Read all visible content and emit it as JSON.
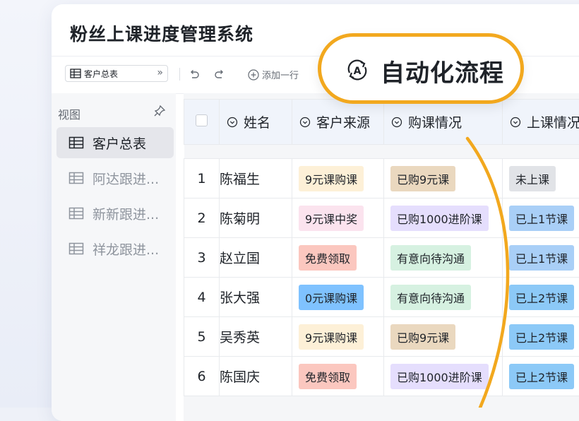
{
  "app": {
    "title": "粉丝上课进度管理系统"
  },
  "toolbar": {
    "view_name": "客户总表",
    "view_icon": "table-icon",
    "expand_icon": "double-chevron-right-icon",
    "undo_icon": "undo-icon",
    "redo_icon": "redo-icon",
    "add_row_label": "添加一行",
    "add_row_icon": "plus-circle-icon"
  },
  "sidebar": {
    "header": "视图",
    "pin_icon": "pin-icon",
    "items": [
      {
        "label": "客户总表",
        "active": true,
        "icon": "table-icon"
      },
      {
        "label": "阿达跟进...",
        "active": false,
        "icon": "table-icon"
      },
      {
        "label": "新新跟进...",
        "active": false,
        "icon": "table-icon"
      },
      {
        "label": "祥龙跟进...",
        "active": false,
        "icon": "table-icon"
      }
    ]
  },
  "table": {
    "columns": [
      "姓名",
      "客户来源",
      "购课情况",
      "上课情况"
    ],
    "column_icon": "select-field-icon",
    "rows": [
      {
        "num": "1",
        "name": "陈福生",
        "source": "9元课购课",
        "purchase": "已购9元课",
        "class": "未上课"
      },
      {
        "num": "2",
        "name": "陈菊明",
        "source": "9元课中奖",
        "purchase": "已购1000进阶课",
        "class": "已上1节课"
      },
      {
        "num": "3",
        "name": "赵立国",
        "source": "免费领取",
        "purchase": "有意向待沟通",
        "class": "已上1节课"
      },
      {
        "num": "4",
        "name": "张大强",
        "source": "0元课购课",
        "purchase": "有意向待沟通",
        "class": "已上2节课"
      },
      {
        "num": "5",
        "name": "吴秀英",
        "source": "9元课购课",
        "purchase": "已购9元课",
        "class": "已上2节课"
      },
      {
        "num": "6",
        "name": "陈国庆",
        "source": "免费领取",
        "purchase": "已购1000进阶课",
        "class": "已上2节课"
      }
    ]
  },
  "tag_colors": {
    "9元课购课": "#fdf0d7",
    "9元课中奖": "#fbe3ee",
    "免费领取": "#fbc7bf",
    "0元课购课": "#7fc2ff",
    "已购9元课": "#ead8bf",
    "已购1000进阶课": "#e5defd",
    "有意向待沟通": "#d6f1e1",
    "未上课": "#e1e3e7",
    "已上1节课": "#a9cff7",
    "已上2节课": "#8cc9f7"
  },
  "callout": {
    "label": "自动化流程",
    "icon": "flow-icon",
    "accent": "#f2a81e"
  }
}
